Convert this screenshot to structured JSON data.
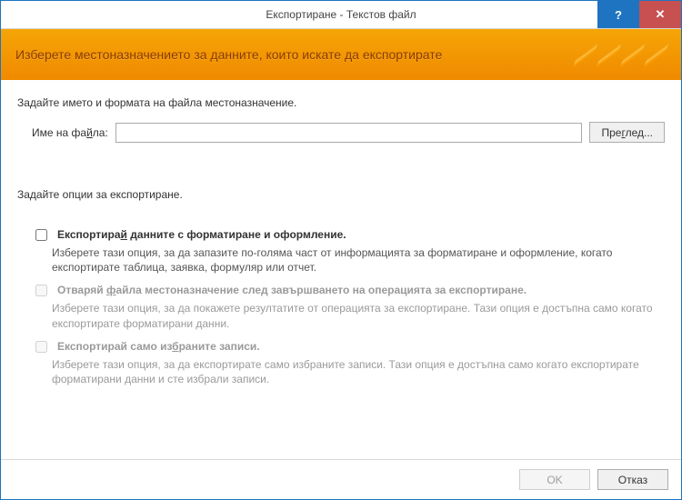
{
  "window": {
    "title": "Експортиране - Текстов файл"
  },
  "banner": {
    "heading": "Изберете местоназначението за данните, които искате да експортирате"
  },
  "destination": {
    "instruction": "Задайте името и формата на файла местоназначение.",
    "filename_label_pre": "Име на фа",
    "filename_label_u": "й",
    "filename_label_post": "ла:",
    "filename_value": "",
    "browse_label_pre": "Пре",
    "browse_label_u": "г",
    "browse_label_post": "лед..."
  },
  "options": {
    "heading": "Задайте опции за експортиране.",
    "items": [
      {
        "title_pre": "Експортира",
        "title_u": "й",
        "title_post": " данните с форматиране и оформление.",
        "desc": "Изберете тази опция, за да запазите по-голяма част от информацията за форматиране и оформление, когато експортирате таблица, заявка, формуляр или отчет.",
        "enabled": true,
        "checked": false
      },
      {
        "title_pre": "Отваряй ",
        "title_u": "ф",
        "title_post": "айла местоназначение след завършването на операцията за експортиране.",
        "desc": "Изберете тази опция, за да покажете резултатите от операцията за експортиране. Тази опция е достъпна само когато експортирате форматирани данни.",
        "enabled": false,
        "checked": false
      },
      {
        "title_pre": "Експортирай само из",
        "title_u": "б",
        "title_post": "раните записи.",
        "desc": "Изберете тази опция, за да експортирате само избраните записи. Тази опция е достъпна само когато експортирате форматирани данни и сте избрали записи.",
        "enabled": false,
        "checked": false
      }
    ]
  },
  "footer": {
    "ok": "OK",
    "cancel": "Отказ",
    "ok_enabled": false
  }
}
